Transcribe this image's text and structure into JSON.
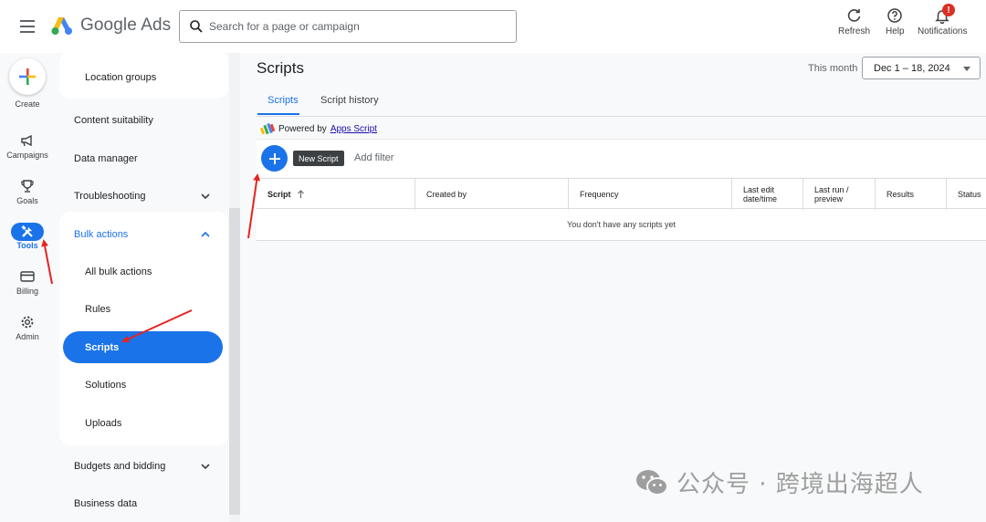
{
  "app": {
    "name": "Google Ads"
  },
  "search": {
    "placeholder": "Search for a page or campaign"
  },
  "header_actions": {
    "refresh": "Refresh",
    "help": "Help",
    "notifications": "Notifications",
    "notification_badge": "!"
  },
  "rail": {
    "create": "Create",
    "campaigns": "Campaigns",
    "goals": "Goals",
    "tools": "Tools",
    "billing": "Billing",
    "admin": "Admin"
  },
  "nav": {
    "location_groups": "Location groups",
    "content_suitability": "Content suitability",
    "data_manager": "Data manager",
    "troubleshooting": "Troubleshooting",
    "bulk_actions": "Bulk actions",
    "all_bulk_actions": "All bulk actions",
    "rules": "Rules",
    "scripts": "Scripts",
    "solutions": "Solutions",
    "uploads": "Uploads",
    "budgets_and_bidding": "Budgets and bidding",
    "business_data": "Business data"
  },
  "main": {
    "title": "Scripts",
    "date_label": "This month",
    "date_range": "Dec 1 – 18, 2024",
    "tabs": [
      "Scripts",
      "Script history"
    ],
    "powered_by": "Powered by",
    "powered_link": "Apps Script",
    "new_script_tooltip": "New Script",
    "add_filter": "Add filter",
    "columns": [
      "Script",
      "Created by",
      "Frequency",
      "Last edit date/time",
      "Last run / preview",
      "Results",
      "Status"
    ],
    "empty_message": "You don't have any scripts yet"
  },
  "watermark": {
    "text": "公众号 · 跨境出海超人"
  },
  "colors": {
    "accent": "#1a73e8",
    "annotation": "#e52420",
    "badge": "#d93025"
  }
}
